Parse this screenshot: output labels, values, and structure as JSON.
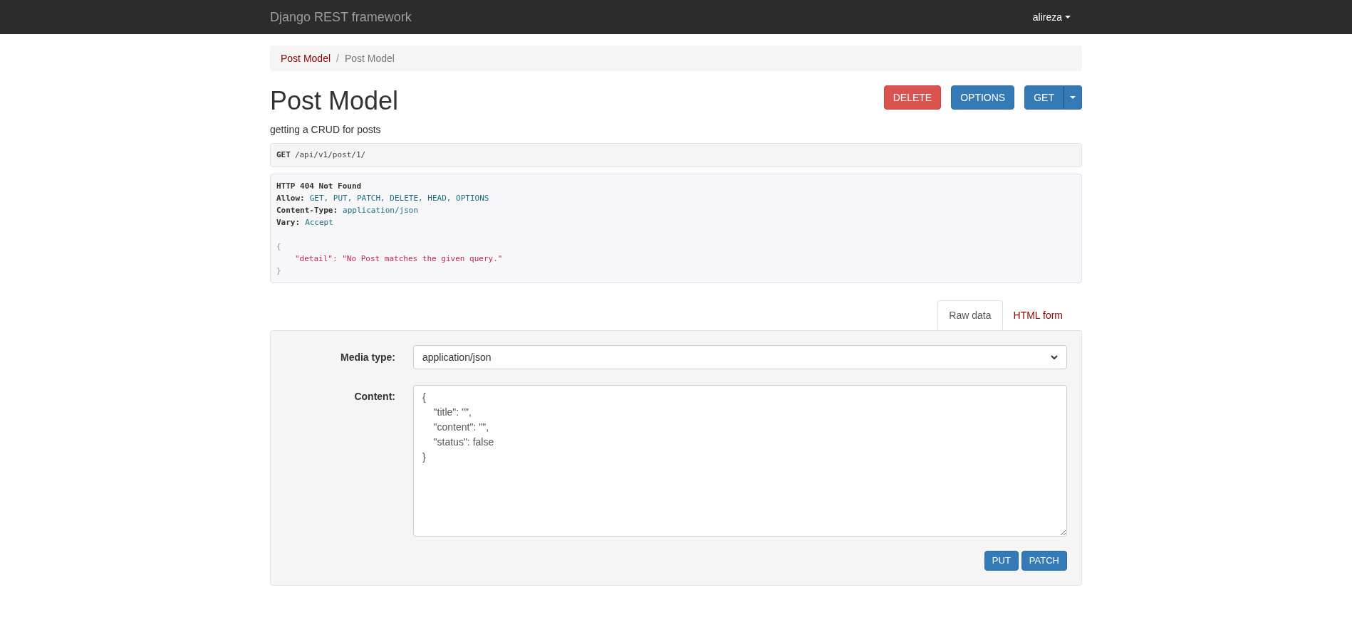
{
  "navbar": {
    "brand": "Django REST framework",
    "user": "alireza"
  },
  "breadcrumb_separator": "/",
  "breadcrumb": [
    {
      "label": "Post Model",
      "selected": false
    },
    {
      "label": "Post Model",
      "selected": true
    }
  ],
  "page": {
    "title": "Post Model",
    "description": "getting a CRUD for posts"
  },
  "actions": [
    {
      "label": "DELETE",
      "kind": "danger"
    },
    {
      "label": "OPTIONS",
      "kind": "primary"
    },
    {
      "label": "GET",
      "kind": "split"
    }
  ],
  "request": {
    "method": "GET",
    "path": "/api/v1/post/1/"
  },
  "response": {
    "status": "HTTP 404 Not Found",
    "headers": [
      {
        "key": "Allow:",
        "value": "GET, PUT, PATCH, DELETE, HEAD, OPTIONS"
      },
      {
        "key": "Content-Type:",
        "value": "application/json"
      },
      {
        "key": "Vary:",
        "value": "Accept"
      }
    ],
    "body": [
      {
        "text": "{",
        "kind": "brace"
      },
      {
        "text": "\"detail\": \"No Post matches the given query.\"",
        "kind": "entry"
      },
      {
        "text": "}",
        "kind": "brace"
      }
    ]
  },
  "form_tabs": [
    {
      "label": "Raw data",
      "selected": true
    },
    {
      "label": "HTML form",
      "selected": false
    }
  ],
  "form": {
    "media_type_label": "Media type:",
    "media_type": "application/json",
    "content_label": "Content:",
    "content": "{\n    \"title\": \"\",\n    \"content\": \"\",\n    \"status\": false\n}",
    "buttons": [
      "PUT",
      "PATCH"
    ]
  }
}
